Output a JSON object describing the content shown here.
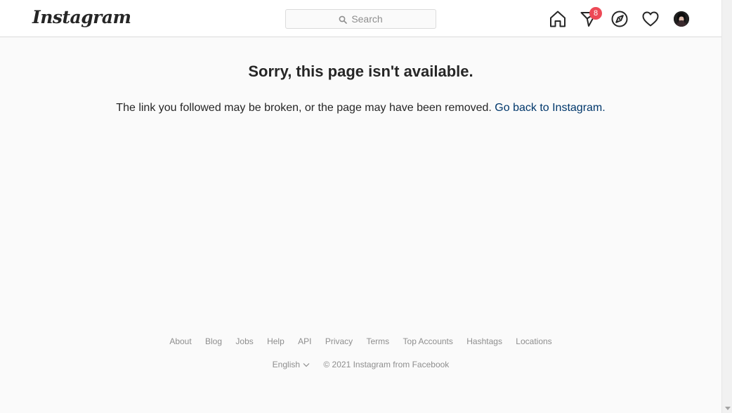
{
  "header": {
    "logo_text": "Instagram",
    "search_placeholder": "Search",
    "direct_badge_count": "8"
  },
  "icons": {
    "search": "search-icon",
    "home": "home-icon",
    "direct": "paper-plane-icon",
    "explore": "compass-icon",
    "activity": "heart-icon",
    "avatar": "profile-avatar"
  },
  "main": {
    "title": "Sorry, this page isn't available.",
    "message": "The link you followed may be broken, or the page may have been removed.",
    "link_text": "Go back to Instagram."
  },
  "footer": {
    "links": [
      "About",
      "Blog",
      "Jobs",
      "Help",
      "API",
      "Privacy",
      "Terms",
      "Top Accounts",
      "Hashtags",
      "Locations"
    ],
    "language": "English",
    "copyright": "© 2021 Instagram from Facebook"
  },
  "colors": {
    "link": "#00376b",
    "badge": "#ed4956",
    "muted_text": "#8e8e8e",
    "border": "#dbdbdb"
  }
}
